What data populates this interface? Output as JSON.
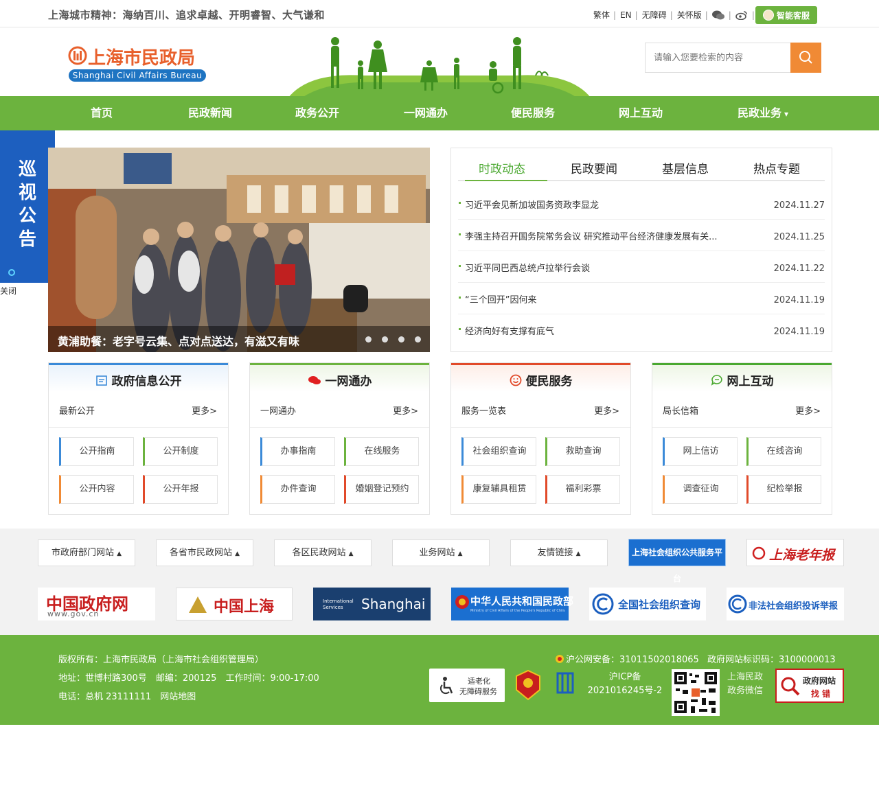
{
  "topbar": {
    "spirit_label": "上海城市精神：",
    "spirit_text": "海纳百川、追求卓越、开明睿智、大气谦和",
    "links": [
      "繁体",
      "EN",
      "无障碍",
      "关怀版"
    ],
    "wechat_icon": "wechat-icon",
    "weibo_icon": "weibo-icon",
    "ai_button": "智能客服"
  },
  "header": {
    "logo_cn": "上海市民政局",
    "logo_en": "Shanghai Civil Affairs Bureau",
    "search_placeholder": "请输入您要检索的内容"
  },
  "nav": [
    "首页",
    "民政新闻",
    "政务公开",
    "一网通办",
    "便民服务",
    "网上互动",
    "民政业务"
  ],
  "nav_dropdown_marker": "▾",
  "patrol": {
    "text": [
      "巡",
      "视",
      "公",
      "告"
    ],
    "close": "关闭"
  },
  "slider": {
    "caption": "黄浦助餐：老字号云集、点对点送达，有滋又有味",
    "dots": 4
  },
  "news": {
    "tabs": [
      "时政动态",
      "民政要闻",
      "基层信息",
      "热点专题"
    ],
    "active_tab": 0,
    "items": [
      {
        "title": "习近平会见新加坡国务资政李显龙",
        "date": "2024.11.27"
      },
      {
        "title": "李强主持召开国务院常务会议 研究推动平台经济健康发展有关...",
        "date": "2024.11.25"
      },
      {
        "title": "习近平同巴西总统卢拉举行会谈",
        "date": "2024.11.22"
      },
      {
        "title": "“三个回开”因何来",
        "date": "2024.11.19"
      },
      {
        "title": "经济向好有支撑有底气",
        "date": "2024.11.19"
      }
    ]
  },
  "cards": [
    {
      "title": "政府信息公开",
      "icon": "calendar-icon",
      "sub": "最新公开",
      "more": "更多>",
      "buttons": [
        "公开指南",
        "公开制度",
        "公开内容",
        "公开年报"
      ],
      "color": "#3b8ad8"
    },
    {
      "title": "一网通办",
      "icon": "chat-bubbles-icon",
      "sub": "一网通办",
      "more": "更多>",
      "buttons": [
        "办事指南",
        "在线服务",
        "办件查询",
        "婚姻登记预约"
      ],
      "color": "#6cb33e"
    },
    {
      "title": "便民服务",
      "icon": "smile-icon",
      "sub": "服务一览表",
      "more": "更多>",
      "buttons": [
        "社会组织查询",
        "救助查询",
        "康复辅具租赁",
        "福利彩票"
      ],
      "color": "#e14a2a"
    },
    {
      "title": "网上互动",
      "icon": "message-icon",
      "sub": "局长信箱",
      "more": "更多>",
      "buttons": [
        "网上信访",
        "在线咨询",
        "调查征询",
        "纪检举报"
      ],
      "color": "#4aa830"
    }
  ],
  "links": {
    "dropdowns": [
      "市政府部门网站",
      "各省市民政网站",
      "各区民政网站",
      "业务网站",
      "友情链接"
    ],
    "banner_social": "上海社会组织公共服务平台",
    "banner_elder": "上海老年报",
    "logos": [
      {
        "main": "中国政府网",
        "sub": "www.gov.cn"
      },
      {
        "main": "中国上海"
      },
      {
        "main": "Shanghai",
        "sub": "International Services"
      },
      {
        "main": "中华人民共和国民政部",
        "sub": "Ministry of Civil Affairs of the People's Republic of China"
      },
      {
        "main": "全国社会组织查询"
      },
      {
        "main": "非法社会组织投诉举报"
      }
    ]
  },
  "footer": {
    "line1": "版权所有：上海市民政局（上海市社会组织管理局）",
    "line2": "地址：世博村路300号　邮编：200125　工作时间：9:00-17:00",
    "line3": "电话：总机 23111111　网站地图",
    "police": "沪公网安备：31011502018065",
    "site_code": "政府网站标识码：3100000013",
    "accessible_1": "适老化",
    "accessible_2": "无障碍服务",
    "icp_1": "沪ICP备",
    "icp_2": "2021016245号-2",
    "wechat_1": "上海民政",
    "wechat_2": "政务微信",
    "findbug_1": "政府网站",
    "findbug_2": "找 错"
  }
}
